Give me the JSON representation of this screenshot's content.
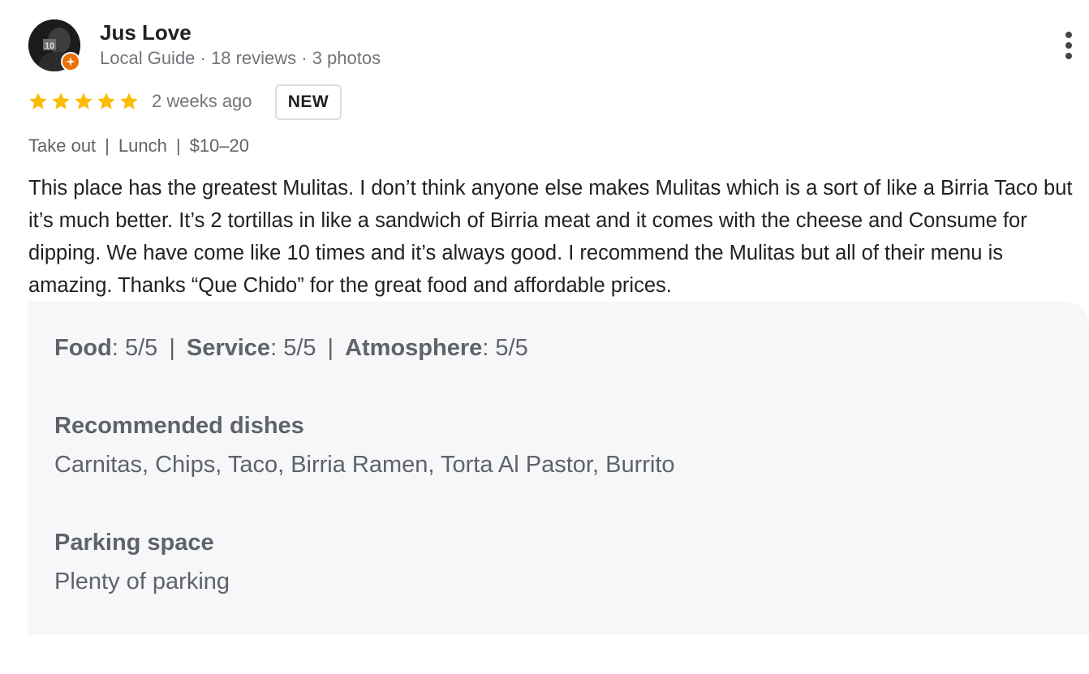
{
  "reviewer": {
    "name": "Jus Love",
    "level": "Local Guide",
    "reviews": "18 reviews",
    "photos": "3 photos",
    "meta_sep": " · "
  },
  "review": {
    "rating_stars": 5,
    "time": "2 weeks ago",
    "new_badge": "NEW",
    "attributes": [
      "Take out",
      "Lunch",
      "$10–20"
    ],
    "attr_sep": "|",
    "text": "This place has the greatest Mulitas. I don’t think anyone else makes Mulitas which is a sort of like a Birria Taco but it’s much better. It’s 2 tortillas in like a sandwich of Birria meat and it comes with the cheese and Consume for dipping. We have come like 10 times and it’s always good. I recommend the Mulitas but all of their menu is amazing. Thanks “Que Chido” for the great food and affordable prices."
  },
  "details": {
    "ratings": [
      {
        "label": "Food",
        "value": "5/5"
      },
      {
        "label": "Service",
        "value": "5/5"
      },
      {
        "label": "Atmosphere",
        "value": "5/5"
      }
    ],
    "label_colon": ":",
    "ratings_sep": "|",
    "recommended_title": "Recommended dishes",
    "recommended_value": "Carnitas, Chips, Taco, Birria Ramen, Torta Al Pastor, Burrito",
    "parking_title": "Parking space",
    "parking_value": "Plenty of parking"
  },
  "colors": {
    "star": "#fbbc04",
    "guide_badge": "#e8710a",
    "panel_bg": "#f6f7f9"
  },
  "icons": {
    "avatar": "profile-photo",
    "badge": "local-guide-badge-icon",
    "more": "more-vert-icon",
    "star": "star-icon"
  }
}
